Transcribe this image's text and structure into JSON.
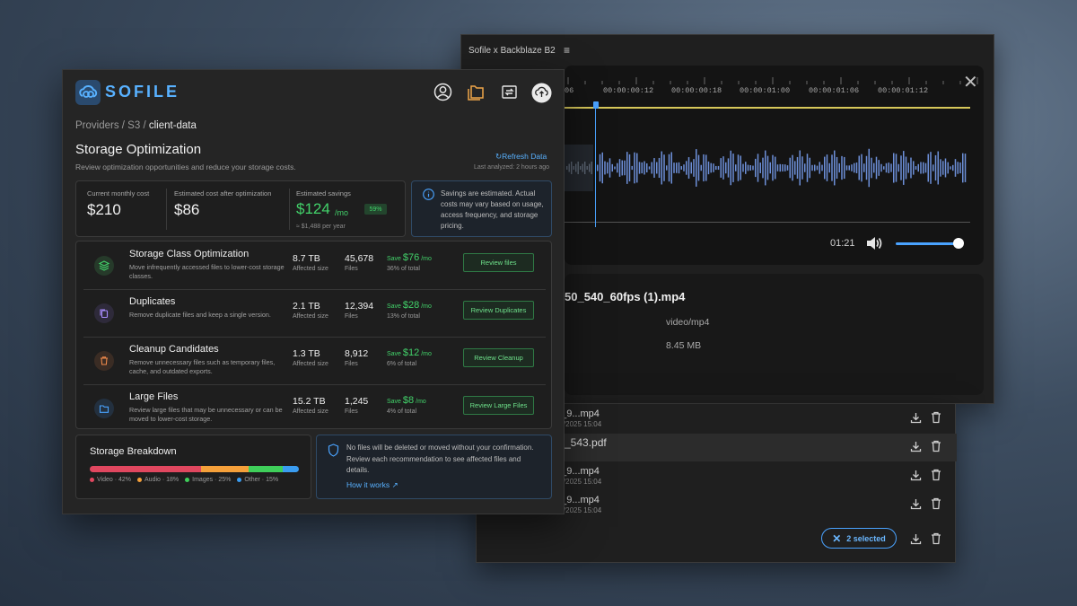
{
  "back_window": {
    "title": "Sofile x Backblaze B2",
    "menu_icon": "hamburger-icon",
    "timeline": [
      "06",
      "00:00:00:12",
      "00:00:00:18",
      "00:00:01:00",
      "00:00:01:06",
      "00:00:01:12"
    ],
    "current_time": "01:21",
    "volume": 0.9,
    "file_name": "50_540_60fps (1).mp4",
    "file_type": "video/mp4",
    "file_size": "8.45 MB"
  },
  "file_list": {
    "rows": [
      {
        "name": "0_9...mp4",
        "date": "18/2025 15:04",
        "active": false
      },
      {
        "name": "nt_543.pdf",
        "date": "18/2025 15:04",
        "active": true
      },
      {
        "name": "0_9...mp4",
        "date": "18/2025 15:04",
        "active": false
      },
      {
        "name": "0_9...mp4",
        "date": "18/2025 15:04",
        "active": false
      }
    ],
    "selected_label": "2 selected"
  },
  "front": {
    "logo": "SOFILE",
    "breadcrumb": {
      "part1": "Providers",
      "part2": "S3",
      "current": "client-data"
    },
    "title": "Storage Optimization",
    "subtitle": "Review optimization opportunities and reduce your storage costs.",
    "refresh": "Refresh Data",
    "last_analyzed": "Last analyzed: 2 hours ago",
    "costs": {
      "current_label": "Current monthly cost",
      "current_value": "$210",
      "after_label": "Estimated cost after optimization",
      "after_value": "$86",
      "savings_label": "Estimated savings",
      "savings_value": "$124",
      "savings_suffix": "/mo",
      "savings_pct": "59%",
      "per_year": "≈ $1,488 per year"
    },
    "note": "Savings are estimated. Actual costs may vary based on usage, access frequency, and storage pricing.",
    "recommendations": [
      {
        "title": "Storage Class Optimization",
        "desc": "Move infrequently accessed files to lower-cost storage classes.",
        "size": "8.7 TB",
        "size_label": "Affected size",
        "files": "45,678",
        "files_label": "Files",
        "save_prefix": "Save",
        "save": "$76",
        "save_suffix": "/mo",
        "pct": "36% of total",
        "button": "Review files",
        "color": "#42d26a",
        "icon": "layers-icon"
      },
      {
        "title": "Duplicates",
        "desc": "Remove duplicate files and keep a single version.",
        "size": "2.1 TB",
        "size_label": "Affected size",
        "files": "12,394",
        "files_label": "Files",
        "save_prefix": "Save",
        "save": "$28",
        "save_suffix": "/mo",
        "pct": "13% of total",
        "button": "Review Duplicates",
        "color": "#a78bfa",
        "icon": "copy-icon"
      },
      {
        "title": "Cleanup Candidates",
        "desc": "Remove unnecessary files such as temporary files, cache, and outdated exports.",
        "size": "1.3 TB",
        "size_label": "Affected size",
        "files": "8,912",
        "files_label": "Files",
        "save_prefix": "Save",
        "save": "$12",
        "save_suffix": "/mo",
        "pct": "6% of total",
        "button": "Review Cleanup",
        "color": "#f08a4b",
        "icon": "trash-icon"
      },
      {
        "title": "Large Files",
        "desc": "Review large files that may be unnecessary or can be moved to lower-cost storage.",
        "size": "15.2 TB",
        "size_label": "Affected size",
        "files": "1,245",
        "files_label": "Files",
        "save_prefix": "Save",
        "save": "$8",
        "save_suffix": "/mo",
        "pct": "4% of total",
        "button": "Review Large Files",
        "color": "#4aa3ff",
        "icon": "folder-icon"
      }
    ],
    "breakdown": {
      "title": "Storage Breakdown",
      "segments": [
        {
          "label": "Video · 42%",
          "value": 42,
          "color": "#e0475f"
        },
        {
          "label": "Audio · 18%",
          "value": 18,
          "color": "#f5a03a"
        },
        {
          "label": "Images · 25%",
          "value": 13,
          "color": "#3fcf5a"
        },
        {
          "label": "Other · 15%",
          "value": 6,
          "color": "#3a9cf0"
        }
      ]
    },
    "safety": {
      "text": "No files will be deleted or moved without your confirmation. Review each recommendation to see affected files and details.",
      "link": "How it works"
    }
  }
}
